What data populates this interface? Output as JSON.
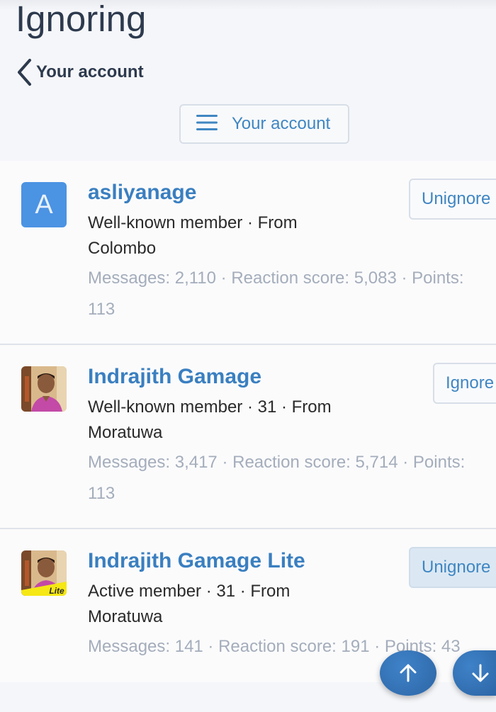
{
  "page": {
    "title": "Ignoring"
  },
  "nav": {
    "back_label": "Your account",
    "menu_label": "Your account"
  },
  "members": [
    {
      "username": "asliyanage",
      "avatar_letter": "A",
      "meta": "Well-known member · From Colombo",
      "stats_line1": "Messages: 2,110 · Reaction score: 5,083 · Points:",
      "stats_line2": "113",
      "action_label": "Unignore"
    },
    {
      "username": "Indrajith Gamage",
      "meta": "Well-known member · 31 · From Moratuwa",
      "stats_line1": "Messages: 3,417 · Reaction score: 5,714 · Points:",
      "stats_line2": "113",
      "action_label": "Ignore"
    },
    {
      "username": "Indrajith Gamage Lite",
      "avatar_badge": "Lite",
      "meta": "Active member · 31 · From Moratuwa",
      "stats_line1": "Messages: 141 · Reaction score: 191 · Points: 43",
      "action_label": "Unignore"
    }
  ],
  "scroll": {
    "up_icon": "arrow-up-icon",
    "down_icon": "arrow-down-icon"
  },
  "colors": {
    "link": "#3a7fc0",
    "title": "#2d3a4e",
    "muted": "#a4adbb",
    "fab": "#2f6cae",
    "avatar_letter_bg": "#4b93e3"
  }
}
